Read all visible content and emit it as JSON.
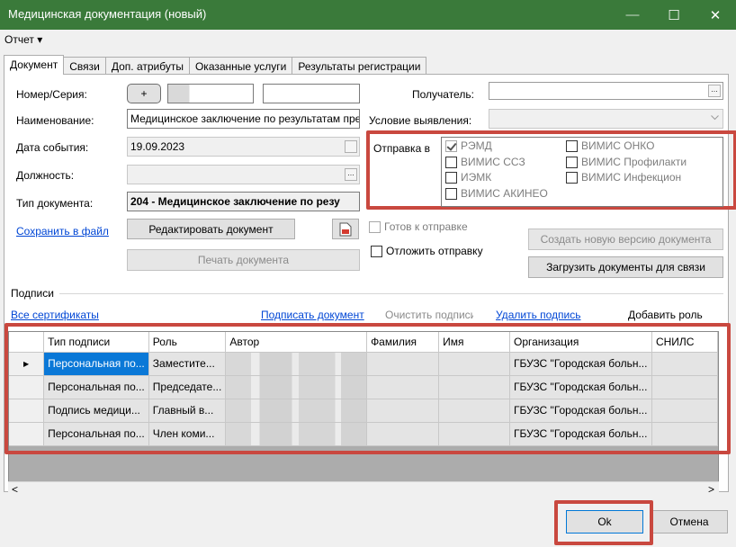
{
  "window": {
    "title": "Медицинская документация (новый)",
    "minimize": "—",
    "maximize": "☐",
    "close": "✕"
  },
  "menu": {
    "report": "Отчет ▾"
  },
  "tabs": [
    "Документ",
    "Связи",
    "Доп. атрибуты",
    "Оказанные услуги",
    "Результаты регистрации"
  ],
  "form": {
    "number_label": "Номер/Серия:",
    "plus_button": "+",
    "name_label": "Наименование:",
    "name_value": "Медицинское заключение по результатам пре",
    "date_label": "Дата события:",
    "date_value": "19.09.2023",
    "position_label": "Должность:",
    "doctype_label": "Тип документа:",
    "doctype_value": "204 - Медицинское заключение по резу",
    "save_link": "Сохранить в файл",
    "edit_button": "Редактировать документ",
    "print_button": "Печать документа",
    "recipient_label": "Получатель:",
    "condition_label": "Условие выявления:",
    "send_to_label": "Отправка в",
    "dots": "..."
  },
  "send_options": [
    {
      "label": "РЭМД",
      "checked": true
    },
    {
      "label": "ВИМИС ОНКО",
      "checked": false
    },
    {
      "label": "ВИМИС ССЗ",
      "checked": false
    },
    {
      "label": "ВИМИС Профилакти",
      "checked": false
    },
    {
      "label": "ИЭМК",
      "checked": false
    },
    {
      "label": "ВИМИС Инфекцион",
      "checked": false
    },
    {
      "label": "ВИМИС АКИНЕО",
      "checked": false
    }
  ],
  "status": {
    "ready_label": "Готов к отправке",
    "postpone_label": "Отложить отправку",
    "new_version_button": "Создать новую версию документа",
    "load_docs_button": "Загрузить документы для связи"
  },
  "signatures": {
    "section_label": "Подписи",
    "all_certs": "Все сертификаты",
    "sign_doc": "Подписать документ",
    "clear_sigs": "Очистить подписи",
    "delete_sig": "Удалить подпись",
    "add_role": "Добавить роль",
    "columns": [
      "Тип подписи",
      "Роль",
      "Автор",
      "Фамилия",
      "Имя",
      "Организация",
      "СНИЛС"
    ],
    "rows": [
      {
        "type": "Персональная по...",
        "role": "Заместите...",
        "org": "ГБУЗС \"Городская больн..."
      },
      {
        "type": "Персональная по...",
        "role": "Председате...",
        "org": "ГБУЗС \"Городская больн..."
      },
      {
        "type": "Подпись медици...",
        "role": "Главный в...",
        "org": "ГБУЗС \"Городская больн..."
      },
      {
        "type": "Персональная по...",
        "role": "Член коми...",
        "org": "ГБУЗС \"Городская больн..."
      }
    ],
    "row_marker": "▶",
    "scroll_left": "<",
    "scroll_right": ">"
  },
  "footer": {
    "ok": "Ok",
    "cancel": "Отмена"
  },
  "colors": {
    "titlebar": "#3a7a3a",
    "highlight": "#c9483f",
    "selection": "#0a78d7",
    "link": "#0046d5"
  }
}
